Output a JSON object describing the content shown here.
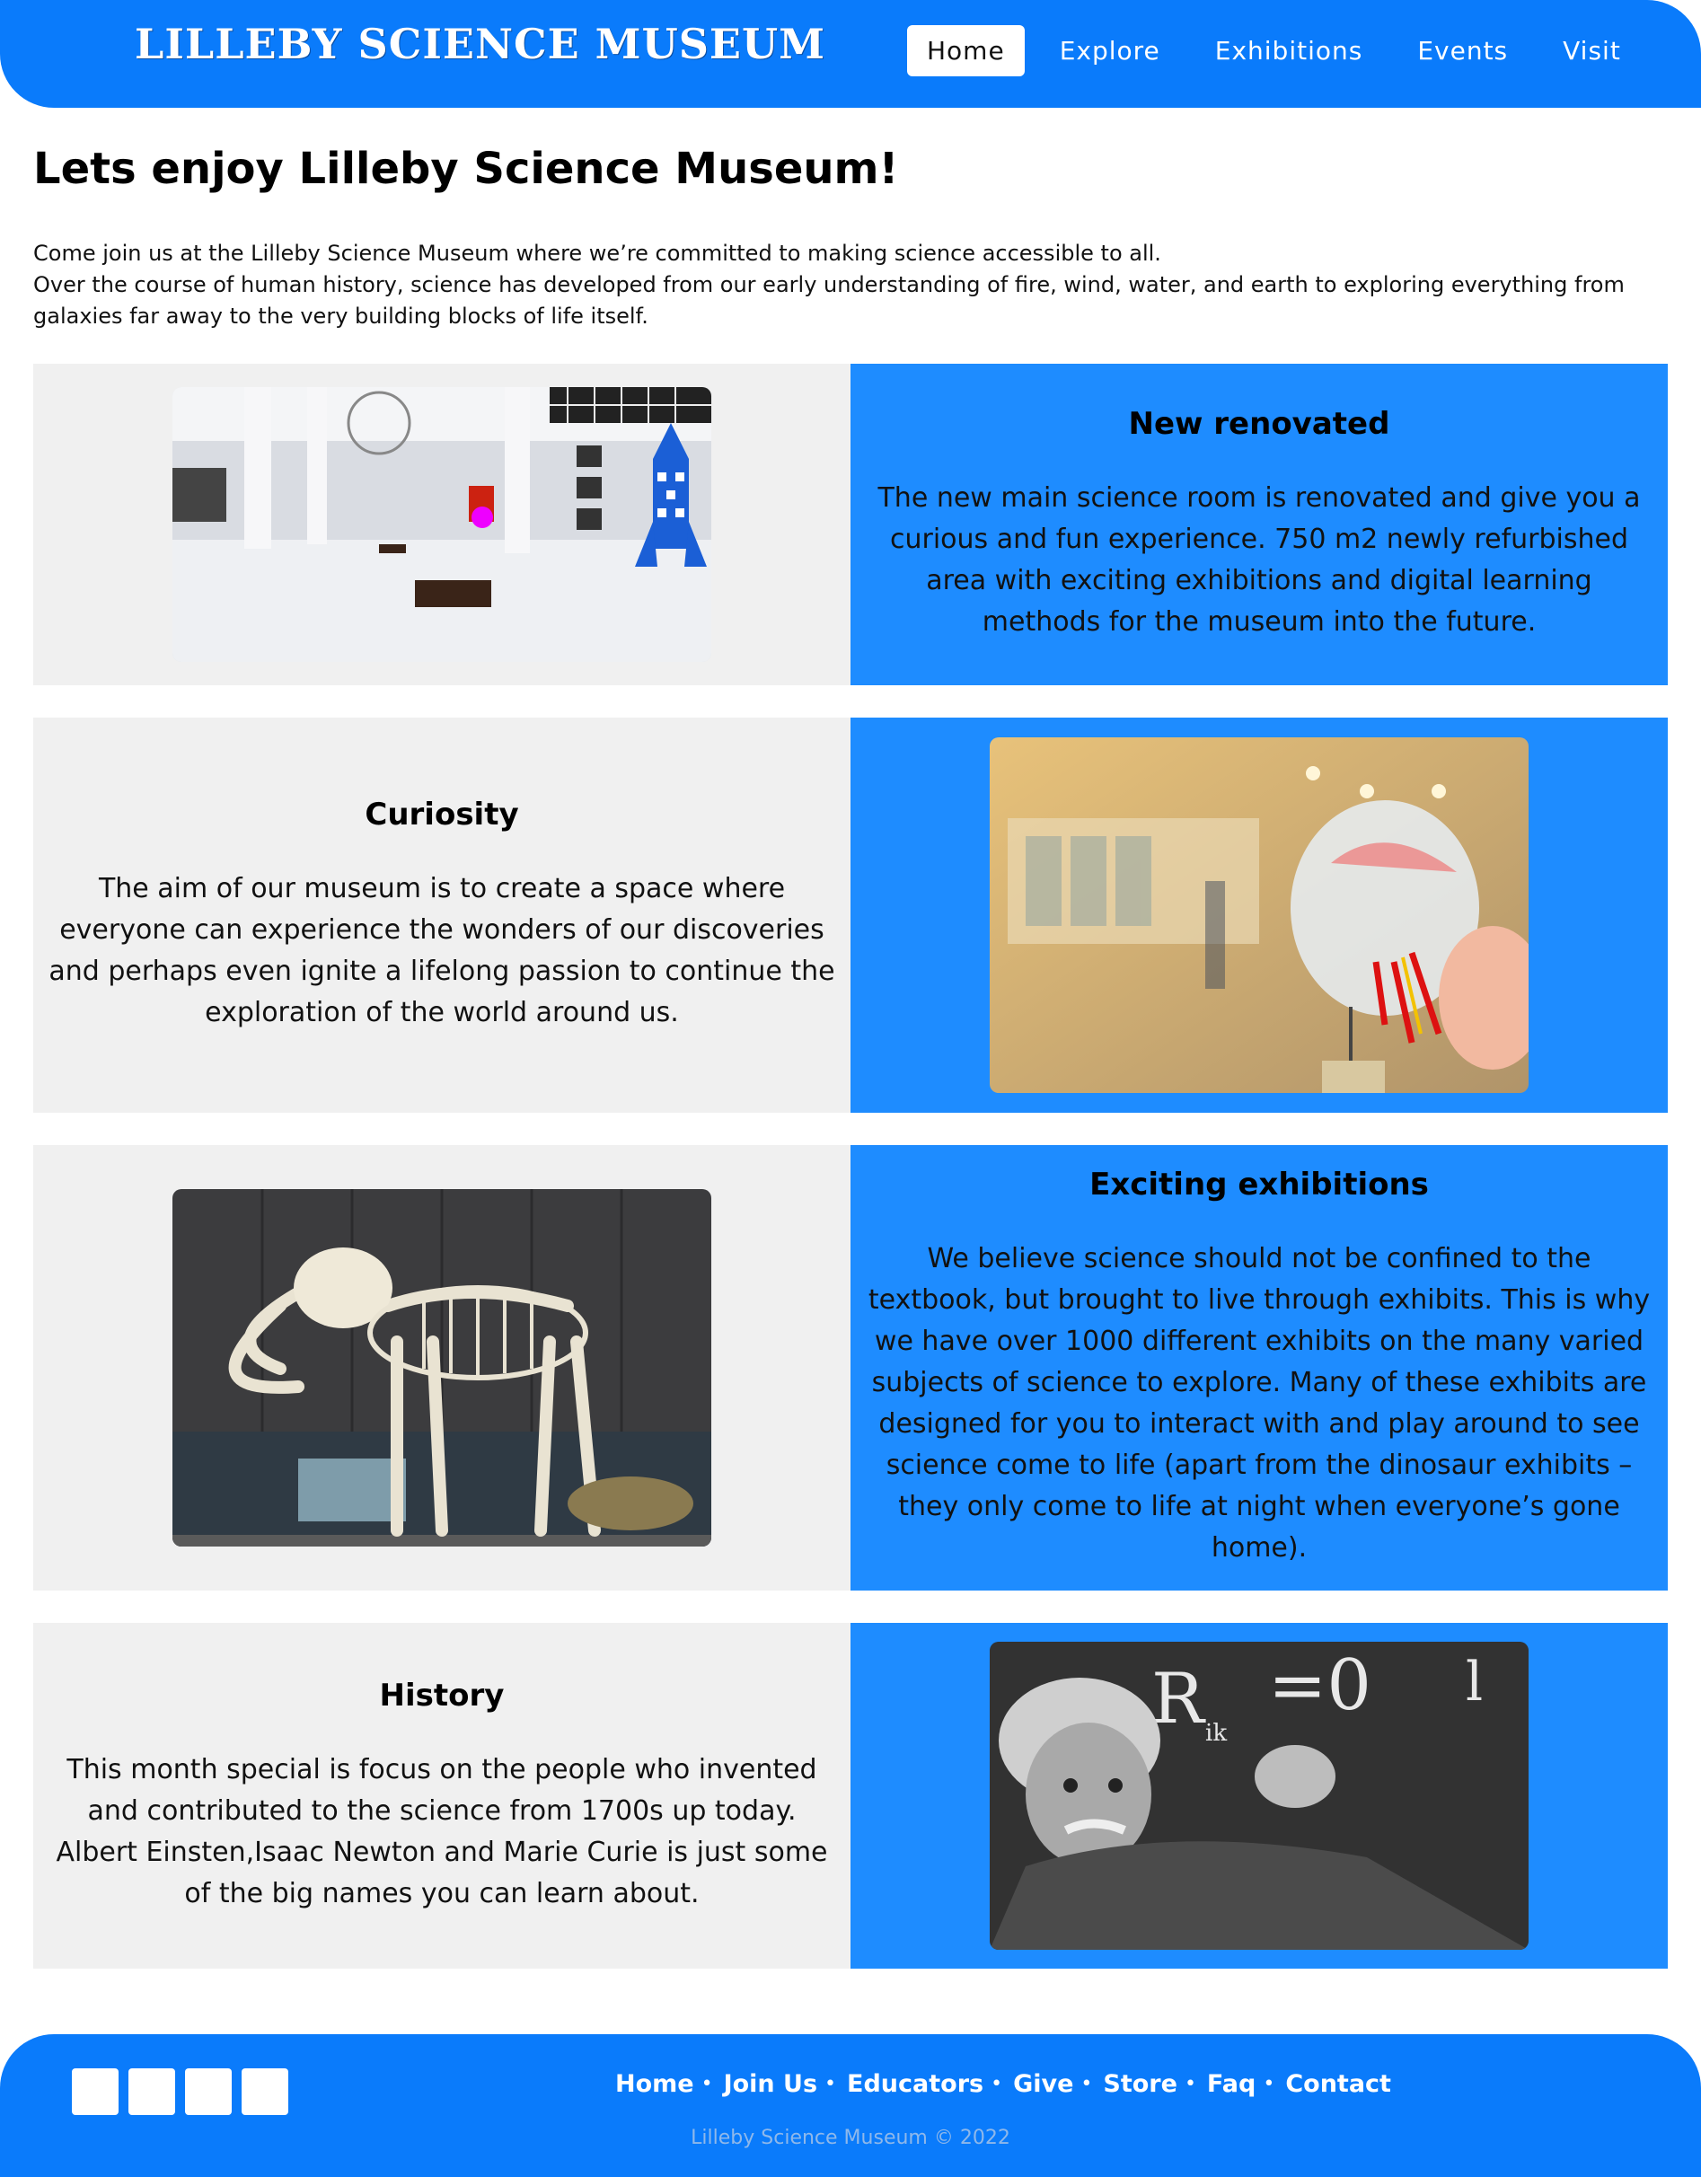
{
  "header": {
    "logo": "LILLEBY SCIENCE MUSEUM",
    "nav": [
      "Home",
      "Explore",
      "Exhibitions",
      "Events",
      "Visit"
    ],
    "active_nav": "Home"
  },
  "intro": {
    "title": "Lets enjoy Lilleby Science Museum!",
    "line1": "Come join us at the Lilleby Science Museum where we’re committed to making science accessible to all.",
    "line2": "Over the course of human history, science has developed from our early understanding of fire, wind, water, and earth to exploring everything from galaxies far away to the very building blocks of life itself."
  },
  "sections": [
    {
      "heading": "New renovated",
      "text": "The new main science room is renovated and give you a curious and fun experience. 750 m2 newly refurbished area with exciting exhibitions and digital learning methods for the museum into the future.",
      "image": "museum-hall-with-rocket"
    },
    {
      "heading": "Curiosity",
      "text": "The aim of our museum is to create a space where everyone can experience the wonders of our discoveries and perhaps even ignite a lifelong passion to continue the exploration of the world around us.",
      "image": "anatomical-skull-model"
    },
    {
      "heading": "Exciting exhibitions",
      "text": "We believe science should not be confined to the textbook, but brought to live through exhibits. This is why we have over 1000 different exhibits on the many varied subjects of science to explore. Many of these exhibits are designed for you to interact with and play around to see science come to life (apart from the dinosaur exhibits – they only come to life at night when everyone’s gone home).",
      "image": "mammoth-skeleton"
    },
    {
      "heading": "History",
      "text": "This month special is focus on the people who invented and contributed to the science from 1700s up today. Albert Einsten,Isaac Newton and Marie Curie is just some of the big names you can learn about.",
      "image": "scientist-at-chalkboard",
      "chalk_text": "R",
      "chalk_sub": "ik",
      "chalk_eq": "=0",
      "chalk_tail": "l"
    }
  ],
  "footer": {
    "links": [
      "Home",
      "Join Us",
      "Educators",
      "Give",
      "Store",
      "Faq",
      "Contact"
    ],
    "copyright": "Lilleby Science Museum © 2022"
  },
  "colors": {
    "primary": "#0a7bfb",
    "panel_blue": "#1e8cff",
    "panel_grey": "#f0f0f0"
  }
}
